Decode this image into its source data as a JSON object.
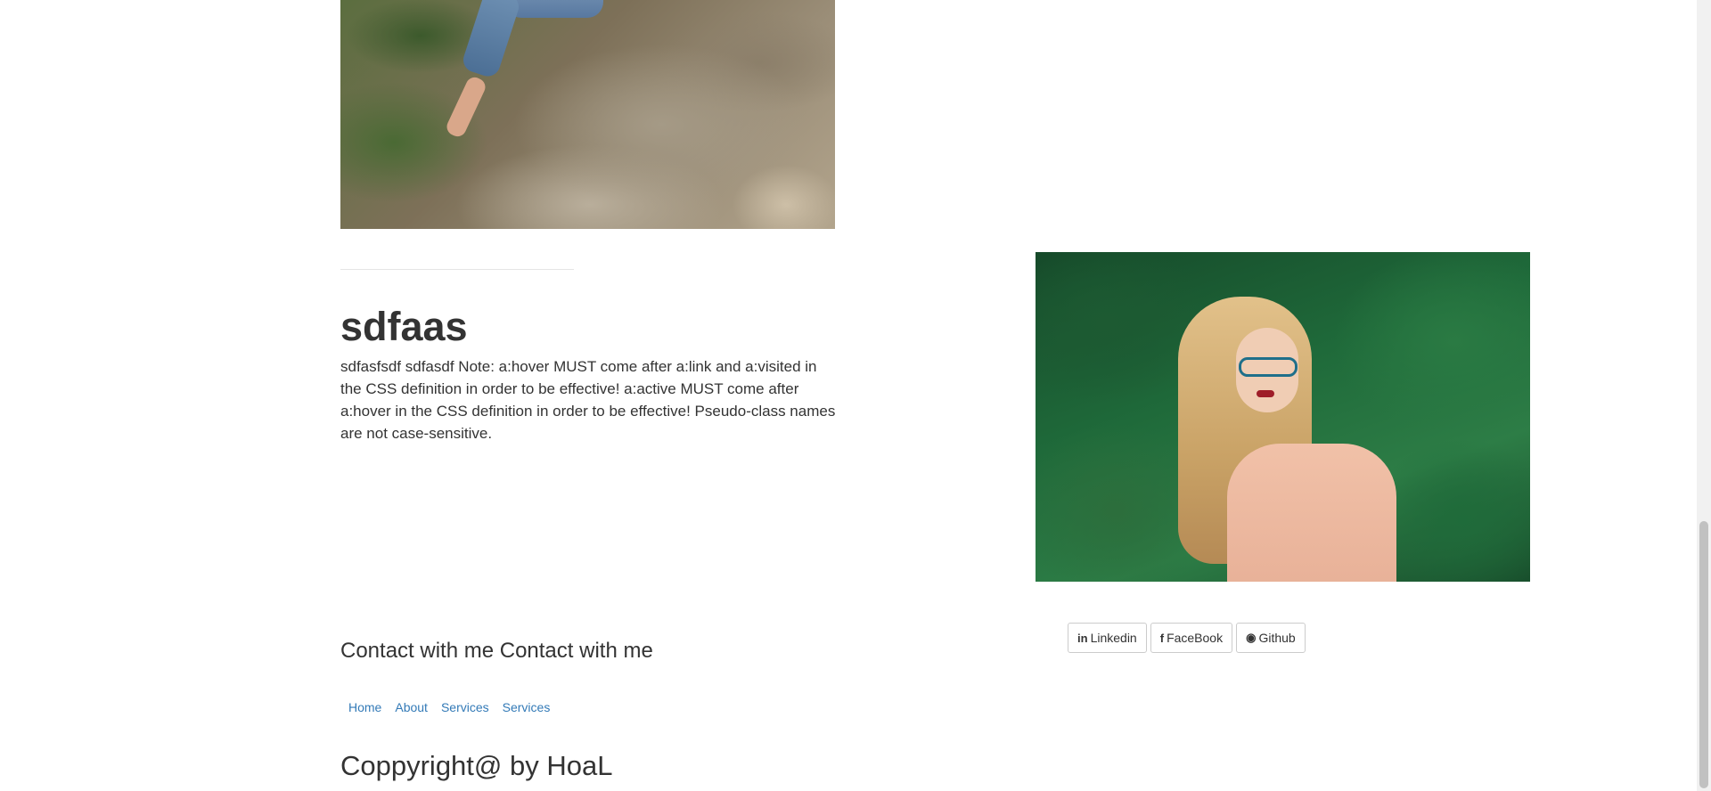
{
  "post": {
    "title": "sdfaas",
    "body": "sdfasfsdf sdfasdf Note: a:hover MUST come after a:link and a:visited in the CSS definition in order to be effective! a:active MUST come after a:hover in the CSS definition in order to be effective! Pseudo-class names are not case-sensitive."
  },
  "contact": {
    "heading": "Contact with me Contact with me"
  },
  "social": {
    "linkedin": {
      "icon": "linkedin-icon",
      "glyph": "in",
      "label": "Linkedin"
    },
    "facebook": {
      "icon": "facebook-icon",
      "glyph": "f",
      "label": "FaceBook"
    },
    "github": {
      "icon": "github-icon",
      "glyph": "◉",
      "label": "Github"
    }
  },
  "footer_nav": [
    "Home",
    "About",
    "Services",
    "Services"
  ],
  "copyright": "Coppyright@ by HoaL",
  "colors": {
    "text": "#333333",
    "link": "#337ab7",
    "button_border": "#cccccc"
  }
}
